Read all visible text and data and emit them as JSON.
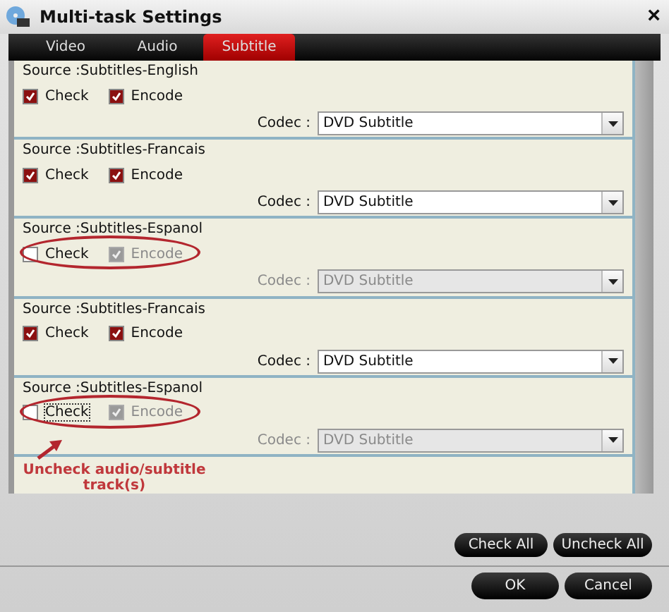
{
  "window": {
    "title": "Multi-task Settings",
    "close": "×"
  },
  "tabs": [
    {
      "label": "Video",
      "selected": false
    },
    {
      "label": "Audio",
      "selected": false
    },
    {
      "label": "Subtitle",
      "selected": true
    }
  ],
  "tracks": [
    {
      "source": "Source :Subtitles-English",
      "check": {
        "label": "Check",
        "checked": true,
        "focused": false
      },
      "encode": {
        "label": "Encode",
        "checked": true,
        "disabled": false
      },
      "codec_label": "Codec :",
      "codec": {
        "value": "DVD Subtitle",
        "disabled": false
      },
      "circled": false
    },
    {
      "source": "Source :Subtitles-Francais",
      "check": {
        "label": "Check",
        "checked": true,
        "focused": false
      },
      "encode": {
        "label": "Encode",
        "checked": true,
        "disabled": false
      },
      "codec_label": "Codec :",
      "codec": {
        "value": "DVD Subtitle",
        "disabled": false
      },
      "circled": false
    },
    {
      "source": "Source :Subtitles-Espanol",
      "check": {
        "label": "Check",
        "checked": false,
        "focused": false
      },
      "encode": {
        "label": "Encode",
        "checked": true,
        "disabled": true
      },
      "codec_label": "Codec :",
      "codec": {
        "value": "DVD Subtitle",
        "disabled": true
      },
      "circled": true
    },
    {
      "source": "Source :Subtitles-Francais",
      "check": {
        "label": "Check",
        "checked": true,
        "focused": false
      },
      "encode": {
        "label": "Encode",
        "checked": true,
        "disabled": false
      },
      "codec_label": "Codec :",
      "codec": {
        "value": "DVD Subtitle",
        "disabled": false
      },
      "circled": false
    },
    {
      "source": "Source :Subtitles-Espanol",
      "check": {
        "label": "Check",
        "checked": false,
        "focused": true
      },
      "encode": {
        "label": "Encode",
        "checked": true,
        "disabled": true
      },
      "codec_label": "Codec :",
      "codec": {
        "value": "DVD Subtitle",
        "disabled": true
      },
      "circled": true
    }
  ],
  "annotation": {
    "text": "Uncheck audio/subtitle track(s)"
  },
  "panel_buttons": [
    "Check All",
    "Uncheck All"
  ],
  "dialog_buttons": [
    "OK",
    "Cancel"
  ]
}
